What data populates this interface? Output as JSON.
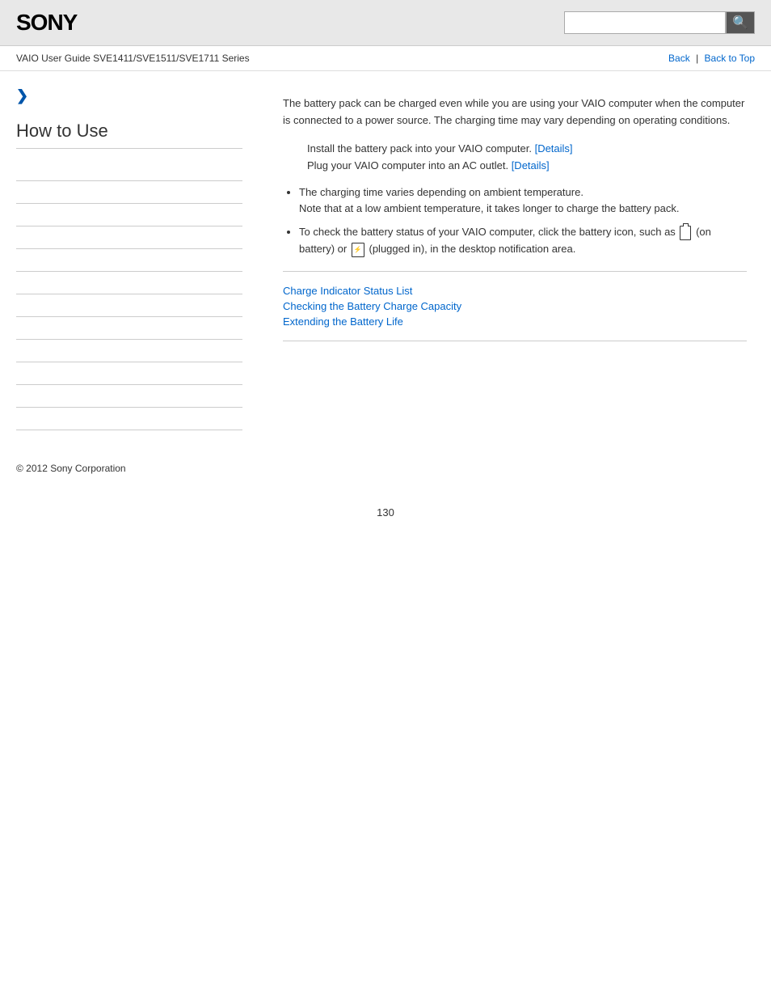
{
  "header": {
    "logo": "SONY",
    "search_placeholder": "",
    "search_icon": "🔍"
  },
  "nav": {
    "guide_title": "VAIO User Guide SVE1411/SVE1511/SVE1711 Series",
    "back_link": "Back",
    "back_top_link": "Back to Top",
    "separator": "|"
  },
  "breadcrumb": {
    "arrow": "❯"
  },
  "sidebar": {
    "title": "How to Use",
    "menu_items": [
      {
        "label": "",
        "href": "#"
      },
      {
        "label": "",
        "href": "#"
      },
      {
        "label": "",
        "href": "#"
      },
      {
        "label": "",
        "href": "#"
      },
      {
        "label": "",
        "href": "#"
      },
      {
        "label": "",
        "href": "#"
      },
      {
        "label": "",
        "href": "#"
      },
      {
        "label": "",
        "href": "#"
      },
      {
        "label": "",
        "href": "#"
      },
      {
        "label": "",
        "href": "#"
      },
      {
        "label": "",
        "href": "#"
      },
      {
        "label": "",
        "href": "#"
      }
    ]
  },
  "content": {
    "intro": "The battery pack can be charged even while you are using your VAIO computer when the computer is connected to a power source. The charging time may vary depending on operating conditions.",
    "step1": "Install the battery pack into your VAIO computer.",
    "step1_link": "[Details]",
    "step2": "Plug your VAIO computer into an AC outlet.",
    "step2_link": "[Details]",
    "note1": "The charging time varies depending on ambient temperature.\nNote that at a low ambient temperature, it takes longer to charge the battery pack.",
    "note2_pre": "To check the battery status of your VAIO computer, click the battery icon, such as",
    "note2_mid": "(on battery) or",
    "note2_post": "(plugged in), in the desktop notification area.",
    "related_links": {
      "link1": "Charge Indicator Status List",
      "link2": "Checking the Battery Charge Capacity",
      "link3": "Extending the Battery Life"
    }
  },
  "footer": {
    "copyright": "© 2012 Sony Corporation"
  },
  "page_number": "130"
}
